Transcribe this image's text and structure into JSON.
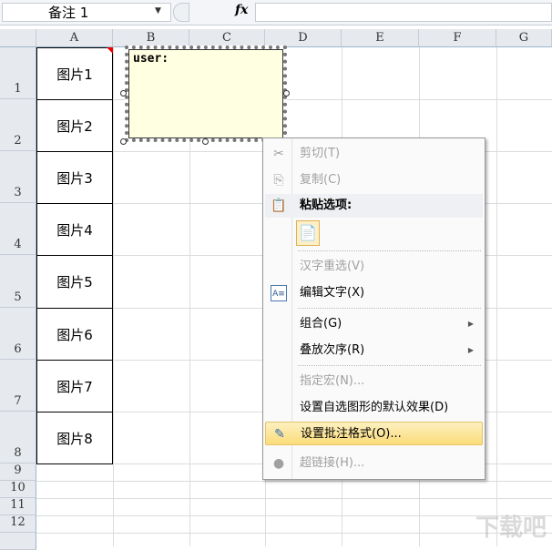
{
  "formula_bar": {
    "name_box": "备注 1",
    "fx": "fx",
    "formula": ""
  },
  "columns": [
    "A",
    "B",
    "C",
    "D",
    "E",
    "F",
    "G"
  ],
  "rows": [
    "1",
    "2",
    "3",
    "4",
    "5",
    "6",
    "7",
    "8",
    "9",
    "10",
    "11",
    "12"
  ],
  "cells_a": [
    "图片1",
    "图片2",
    "图片3",
    "图片4",
    "图片5",
    "图片6",
    "图片7",
    "图片8"
  ],
  "comment": {
    "text": "user:"
  },
  "menu": {
    "cut": "剪切(T)",
    "copy": "复制(C)",
    "paste_options": "粘贴选项:",
    "reconvert": "汉字重选(V)",
    "edit_text": "编辑文字(X)",
    "group": "组合(G)",
    "order": "叠放次序(R)",
    "macro": "指定宏(N)...",
    "default_effect": "设置自选图形的默认效果(D)",
    "format_comment": "设置批注格式(O)...",
    "hyperlink": "超链接(H)..."
  },
  "watermark": "下载吧"
}
